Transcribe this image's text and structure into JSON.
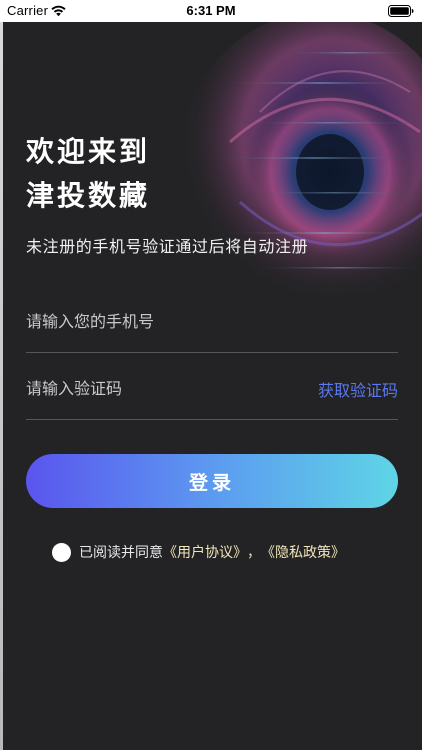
{
  "status_bar": {
    "carrier": "Carrier",
    "time": "6:31 PM",
    "wifi_icon": "wifi-icon",
    "battery_icon": "battery-icon"
  },
  "welcome": {
    "line1": "欢迎来到",
    "line2": "津投数藏",
    "subtitle": "未注册的手机号验证通过后将自动注册"
  },
  "form": {
    "phone_placeholder": "请输入您的手机号",
    "code_placeholder": "请输入验证码",
    "get_code_label": "获取验证码",
    "login_label": "登录"
  },
  "agreement": {
    "prefix": "已阅读并同意",
    "user_agreement": "《用户协议》",
    "separator": "，",
    "privacy_policy": "《隐私政策》"
  },
  "colors": {
    "background": "#232325",
    "accent_link": "#5a78f0",
    "agreement_link": "#f1e4b8",
    "button_gradient_start": "#5a55ee",
    "button_gradient_end": "#5ed5e6"
  }
}
